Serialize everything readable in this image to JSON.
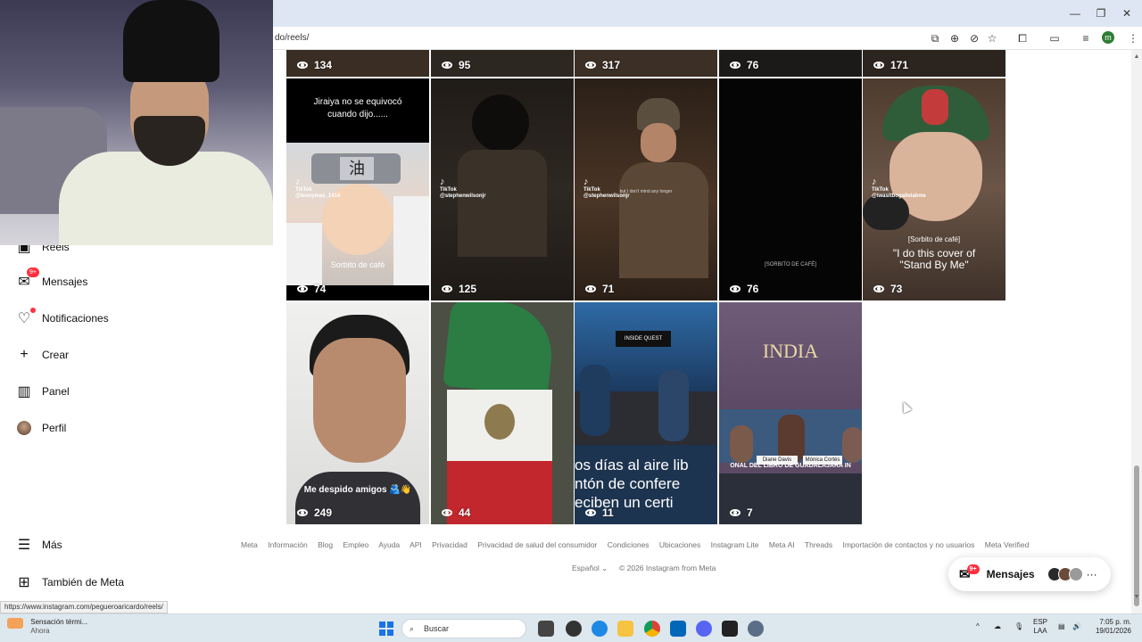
{
  "browser": {
    "url_partial": "do/reels/",
    "status_url": "https://www.instagram.com/pegueroaricardo/reels/"
  },
  "sidebar": {
    "items": [
      {
        "label": "Reels",
        "icon": "reels-icon"
      },
      {
        "label": "Mensajes",
        "icon": "messenger-icon",
        "badge": "9+"
      },
      {
        "label": "Notificaciones",
        "icon": "heart-icon"
      },
      {
        "label": "Crear",
        "icon": "plus-icon"
      },
      {
        "label": "Panel",
        "icon": "chart-icon"
      },
      {
        "label": "Perfil",
        "icon": "avatar"
      }
    ],
    "more_label": "Más",
    "meta_label": "También de Meta"
  },
  "reels": {
    "row1": [
      {
        "views": "134"
      },
      {
        "views": "95"
      },
      {
        "views": "317"
      },
      {
        "views": "76"
      },
      {
        "views": "171"
      }
    ],
    "row2": [
      {
        "views": "74",
        "caption_top": "Jiraiya no se equivocó cuando dijo......",
        "caption_bottom": "Sorbito de café",
        "tiktok_user": "@leonymas_1414"
      },
      {
        "views": "125",
        "tiktok_user": "@stephenwilsonjr"
      },
      {
        "views": "71",
        "caption_mid": "but I don't mind any longer",
        "tiktok_user": "@stephenwilsonjr"
      },
      {
        "views": "76",
        "caption_mid": "[SORBITO DE CAFÉ]"
      },
      {
        "views": "73",
        "caption_small": "[Sorbito de café]",
        "caption_big": "\"I do this cover of \"Stand By Me\"",
        "tiktok_user": "@iwasitbogallelabme"
      }
    ],
    "row3": [
      {
        "views": "249",
        "caption": "Me despido amigos 🫂👋"
      },
      {
        "views": "44"
      },
      {
        "views": "11",
        "caption_lines": [
          "os días al aire lib",
          "ntón de confere",
          "eciben un certi"
        ],
        "banner": "INSIDE QUEST"
      },
      {
        "views": "7",
        "banner_top": "INDIA",
        "banner_bottom": "ONAL DEL LIBRO DE GUADALAJARA IN",
        "nameplate_a": "Diane Davis",
        "nameplate_b": "Mónica Cortés"
      }
    ]
  },
  "footer": {
    "links": [
      "Meta",
      "Información",
      "Blog",
      "Empleo",
      "Ayuda",
      "API",
      "Privacidad",
      "Privacidad de salud del consumidor",
      "Condiciones",
      "Ubicaciones",
      "Instagram Lite",
      "Meta AI",
      "Threads",
      "Importación de contactos y no usuarios",
      "Meta Verified"
    ],
    "language": "Español",
    "copyright": "© 2026 Instagram from Meta"
  },
  "messages_widget": {
    "label": "Mensajes",
    "badge": "9+"
  },
  "taskbar": {
    "weather_title": "Sensación térmi...",
    "weather_sub": "Ahora",
    "search_placeholder": "Buscar",
    "lang_top": "ESP",
    "lang_bottom": "LAA",
    "time": "7:05 p. m.",
    "date": "19/01/2026"
  },
  "colors": {
    "accent_red": "#ff3040",
    "taskbar_bg": "#dde7ee",
    "titlebar_bg": "#dfe6f3"
  }
}
